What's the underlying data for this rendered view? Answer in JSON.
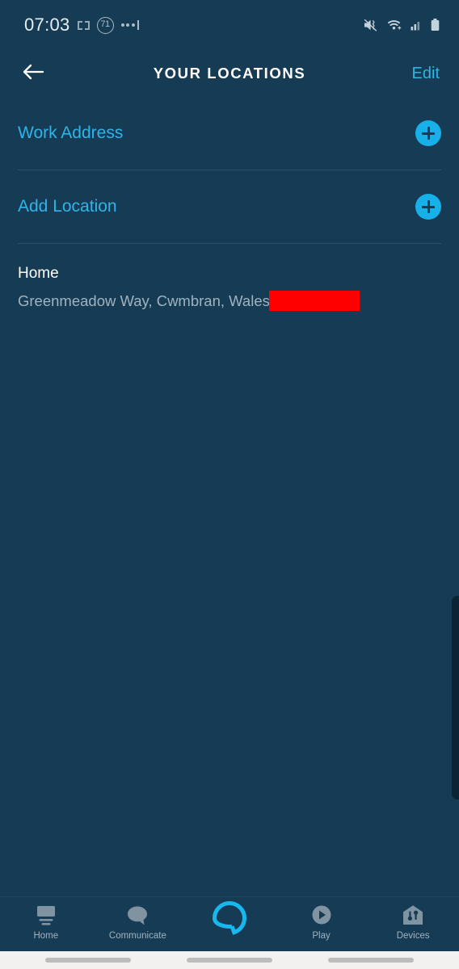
{
  "colors": {
    "background": "#163b54",
    "accent": "#2fb4e9",
    "plus_button": "#18b0e8",
    "title_text": "#ffffff",
    "secondary_text": "#9fb3c0",
    "divider": "#2b4f67",
    "redaction": "#ff0000",
    "gesture_bar_bg": "#f2f1f0"
  },
  "status_bar": {
    "clock": "07:03",
    "circle_badge": "71",
    "icons": {
      "crop": "crop-brackets-icon",
      "overflow": "more-dots-icon",
      "sound": "mute-vibrate-icon",
      "wifi": "wifi-icon",
      "signal": "cellular-signal-icon",
      "battery": "battery-icon"
    }
  },
  "title_bar": {
    "back": "back-arrow-icon",
    "title": "YOUR LOCATIONS",
    "edit_label": "Edit"
  },
  "locations": {
    "rows": [
      {
        "label": "Work Address",
        "action": "add-icon"
      },
      {
        "label": "Add Location",
        "action": "add-icon"
      }
    ],
    "saved": {
      "name": "Home",
      "address": "Greenmeadow Way, Cwmbran, Wales",
      "redacted": true
    }
  },
  "bottom_nav": {
    "items": [
      {
        "label": "Home",
        "icon": "echo-show-icon"
      },
      {
        "label": "Communicate",
        "icon": "speech-bubble-icon"
      },
      {
        "label": "",
        "icon": "alexa-ring-icon"
      },
      {
        "label": "Play",
        "icon": "play-circle-icon"
      },
      {
        "label": "Devices",
        "icon": "smart-home-icon"
      }
    ]
  }
}
